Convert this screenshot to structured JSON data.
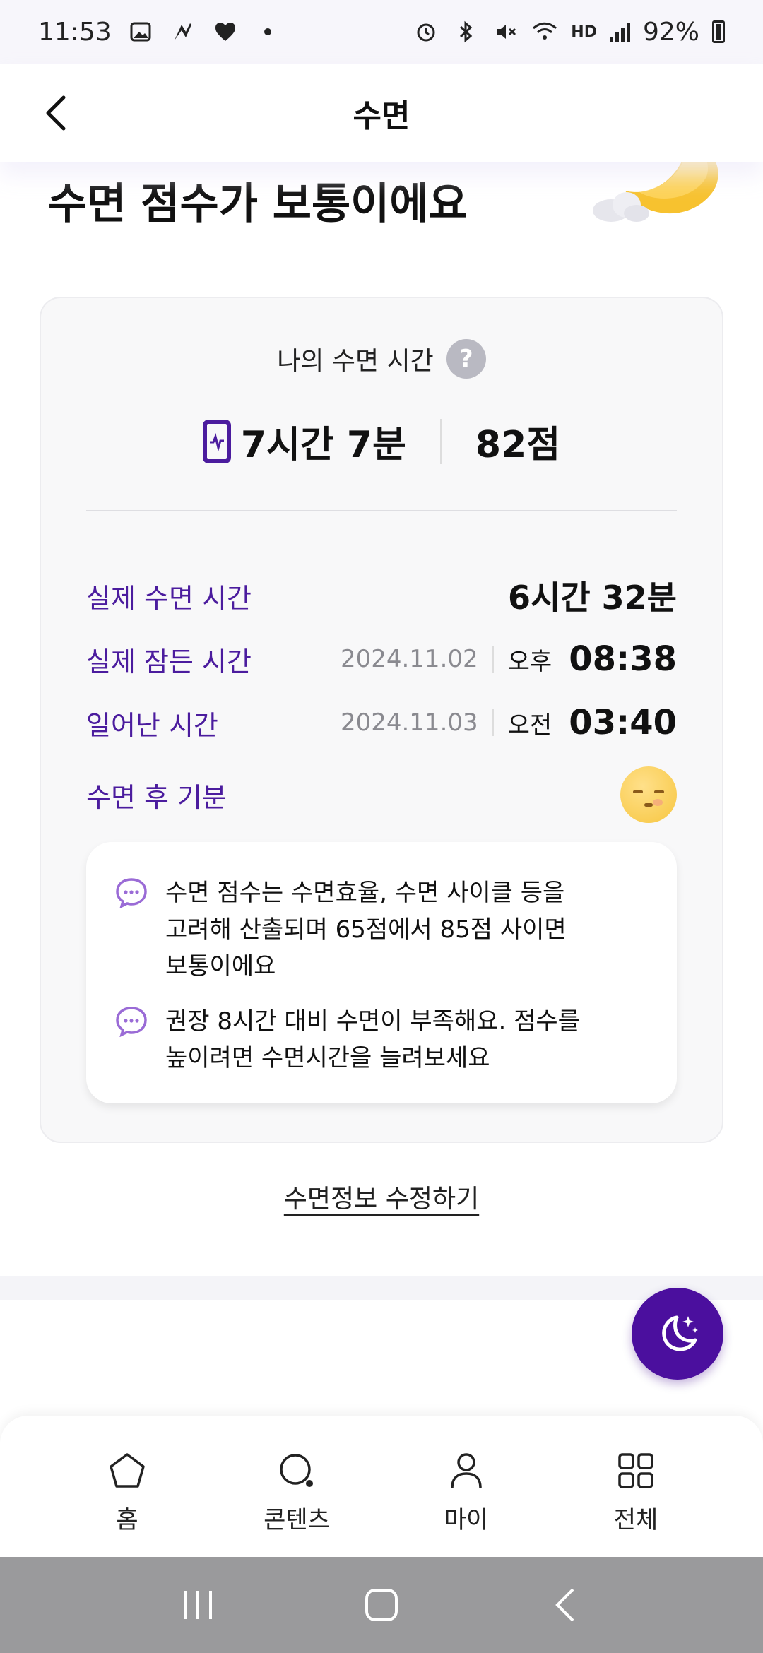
{
  "status_bar": {
    "time": "11:53",
    "network": "HD",
    "battery": "92%"
  },
  "header": {
    "title": "수면"
  },
  "hero": {
    "title": "수면 점수가 보통이에요"
  },
  "card": {
    "subtitle": "나의 수면 시간",
    "total_time": "7시간 7분",
    "score": "82점",
    "rows": [
      {
        "label": "실제 수면 시간",
        "value": "6시간 32분"
      },
      {
        "label": "실제 잠든 시간",
        "date": "2024.11.02",
        "ampm": "오후",
        "time": "08:38"
      },
      {
        "label": "일어난 시간",
        "date": "2024.11.03",
        "ampm": "오전",
        "time": "03:40"
      },
      {
        "label": "수면 후 기분"
      }
    ],
    "info": [
      {
        "line1": "수면 점수는 수면효율, 수면 사이클 등을",
        "line2": "고려해 산출되며 65점에서 85점 사이면",
        "line3": "보통이에요"
      },
      {
        "line1": "권장 8시간 대비 수면이 부족해요. 점수를",
        "line2": "높이려면 수면시간을 늘려보세요"
      }
    ]
  },
  "edit_link": "수면정보 수정하기",
  "bottom_nav": [
    {
      "label": "홈",
      "icon": "home-icon"
    },
    {
      "label": "콘텐츠",
      "icon": "search-icon"
    },
    {
      "label": "마이",
      "icon": "person-icon"
    },
    {
      "label": "전체",
      "icon": "grid-icon"
    }
  ],
  "colors": {
    "accent": "#4b1c9e",
    "fab": "#4b0f9e"
  }
}
